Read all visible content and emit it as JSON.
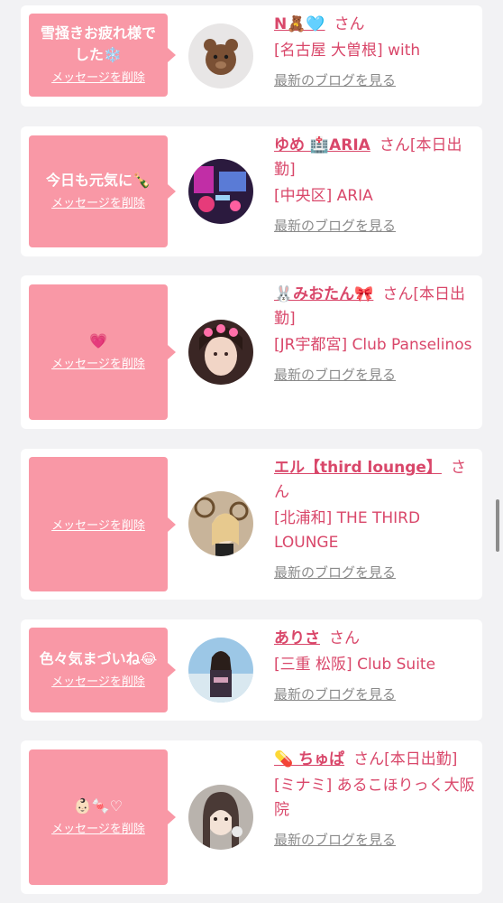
{
  "messages": [
    {
      "bubble_text": "雪掻きお疲れ様でした❄️",
      "delete_label": "メッセージを削除",
      "name": "N🧸🩵",
      "san_label": "さん",
      "shop": "[名古屋 大曽根] with",
      "blog_label": "最新のブログを見る"
    },
    {
      "bubble_text": "今日も元気に🍾",
      "delete_label": "メッセージを削除",
      "name": "ゆめ 🏥ARIA",
      "san_label": "さん[本日出勤]",
      "shop": "[中央区] ARIA",
      "blog_label": "最新のブログを見る"
    },
    {
      "bubble_text": "💗",
      "delete_label": "メッセージを削除",
      "name": "🐰みおたん🎀",
      "san_label": "さん[本日出勤]",
      "shop": "[JR宇都宮] Club Panselinos",
      "blog_label": "最新のブログを見る"
    },
    {
      "bubble_text": "",
      "delete_label": "メッセージを削除",
      "name": "エル【third lounge】",
      "san_label": "さん",
      "shop": "[北浦和] THE THIRD LOUNGE",
      "blog_label": "最新のブログを見る"
    },
    {
      "bubble_text": "色々気まづいね😂",
      "delete_label": "メッセージを削除",
      "name": "ありさ",
      "san_label": "さん",
      "shop": "[三重 松阪] Club Suite",
      "blog_label": "最新のブログを見る"
    },
    {
      "bubble_text": "👶🏻🍬♡",
      "delete_label": "メッセージを削除",
      "name": "💊 ちゅぱ",
      "san_label": "さん[本日出勤]",
      "shop": "[ミナミ] あるこほりっく大阪院",
      "blog_label": "最新のブログを見る"
    }
  ],
  "colors": {
    "accent": "#d9476a",
    "bubble": "#f998a6",
    "background": "#f2f2f4",
    "link_gray": "#8a8a8a"
  }
}
